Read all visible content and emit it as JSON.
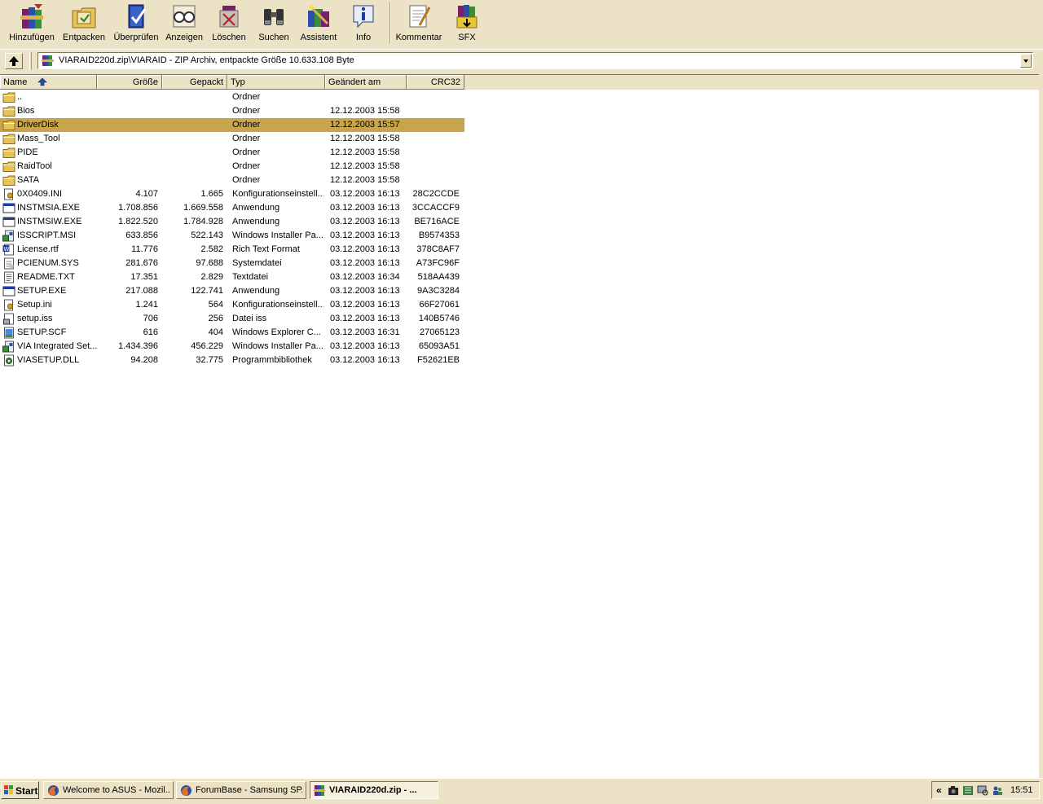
{
  "toolbar": {
    "buttons": [
      {
        "label": "Hinzufügen",
        "icon": "books-add-icon"
      },
      {
        "label": "Entpacken",
        "icon": "extract-folder-icon"
      },
      {
        "label": "Überprüfen",
        "icon": "test-book-icon"
      },
      {
        "label": "Anzeigen",
        "icon": "view-glasses-icon"
      },
      {
        "label": "Löschen",
        "icon": "delete-book-icon"
      },
      {
        "label": "Suchen",
        "icon": "binoculars-icon"
      },
      {
        "label": "Assistent",
        "icon": "wizard-icon"
      },
      {
        "label": "Info",
        "icon": "info-icon"
      },
      {
        "label": "Kommentar",
        "icon": "comment-notepad-icon"
      },
      {
        "label": "SFX",
        "icon": "sfx-icon"
      }
    ]
  },
  "address": {
    "path": "VIARAID220d.zip\\VIARAID - ZIP Archiv, entpackte Größe 10.633.108 Byte"
  },
  "columns": {
    "name": "Name",
    "size": "Größe",
    "packed": "Gepackt",
    "type": "Typ",
    "modified": "Geändert am",
    "crc": "CRC32"
  },
  "files": [
    {
      "name": "..",
      "size": "",
      "packed": "",
      "type": "Ordner",
      "modified": "",
      "crc": "",
      "icon": "folder"
    },
    {
      "name": "Bios",
      "size": "",
      "packed": "",
      "type": "Ordner",
      "modified": "12.12.2003 15:58",
      "crc": "",
      "icon": "folder"
    },
    {
      "name": "DriverDisk",
      "size": "",
      "packed": "",
      "type": "Ordner",
      "modified": "12.12.2003 15:57",
      "crc": "",
      "icon": "folder",
      "selected": true
    },
    {
      "name": "Mass_Tool",
      "size": "",
      "packed": "",
      "type": "Ordner",
      "modified": "12.12.2003 15:58",
      "crc": "",
      "icon": "folder"
    },
    {
      "name": "PIDE",
      "size": "",
      "packed": "",
      "type": "Ordner",
      "modified": "12.12.2003 15:58",
      "crc": "",
      "icon": "folder"
    },
    {
      "name": "RaidTool",
      "size": "",
      "packed": "",
      "type": "Ordner",
      "modified": "12.12.2003 15:58",
      "crc": "",
      "icon": "folder"
    },
    {
      "name": "SATA",
      "size": "",
      "packed": "",
      "type": "Ordner",
      "modified": "12.12.2003 15:58",
      "crc": "",
      "icon": "folder"
    },
    {
      "name": "0X0409.INI",
      "size": "4.107",
      "packed": "1.665",
      "type": "Konfigurationseinstell...",
      "modified": "03.12.2003 16:13",
      "crc": "28C2CCDE",
      "icon": "ini"
    },
    {
      "name": "INSTMSIA.EXE",
      "size": "1.708.856",
      "packed": "1.669.558",
      "type": "Anwendung",
      "modified": "03.12.2003 16:13",
      "crc": "3CCACCF9",
      "icon": "exe"
    },
    {
      "name": "INSTMSIW.EXE",
      "size": "1.822.520",
      "packed": "1.784.928",
      "type": "Anwendung",
      "modified": "03.12.2003 16:13",
      "crc": "BE716ACE",
      "icon": "exe"
    },
    {
      "name": "ISSCRIPT.MSI",
      "size": "633.856",
      "packed": "522.143",
      "type": "Windows Installer Pa...",
      "modified": "03.12.2003 16:13",
      "crc": "B9574353",
      "icon": "msi"
    },
    {
      "name": "License.rtf",
      "size": "11.776",
      "packed": "2.582",
      "type": "Rich Text Format",
      "modified": "03.12.2003 16:13",
      "crc": "378C8AF7",
      "icon": "rtf"
    },
    {
      "name": "PCIENUM.SYS",
      "size": "281.676",
      "packed": "97.688",
      "type": "Systemdatei",
      "modified": "03.12.2003 16:13",
      "crc": "A73FC96F",
      "icon": "sys"
    },
    {
      "name": "README.TXT",
      "size": "17.351",
      "packed": "2.829",
      "type": "Textdatei",
      "modified": "03.12.2003 16:34",
      "crc": "518AA439",
      "icon": "txt"
    },
    {
      "name": "SETUP.EXE",
      "size": "217.088",
      "packed": "122.741",
      "type": "Anwendung",
      "modified": "03.12.2003 16:13",
      "crc": "9A3C3284",
      "icon": "exe"
    },
    {
      "name": "Setup.ini",
      "size": "1.241",
      "packed": "564",
      "type": "Konfigurationseinstell...",
      "modified": "03.12.2003 16:13",
      "crc": "66F27061",
      "icon": "ini"
    },
    {
      "name": "setup.iss",
      "size": "706",
      "packed": "256",
      "type": "Datei iss",
      "modified": "03.12.2003 16:13",
      "crc": "140B5746",
      "icon": "generic"
    },
    {
      "name": "SETUP.SCF",
      "size": "616",
      "packed": "404",
      "type": "Windows Explorer C...",
      "modified": "03.12.2003 16:31",
      "crc": "27065123",
      "icon": "scf"
    },
    {
      "name": "VIA Integrated Set...",
      "size": "1.434.396",
      "packed": "456.229",
      "type": "Windows Installer Pa...",
      "modified": "03.12.2003 16:13",
      "crc": "65093A51",
      "icon": "msi"
    },
    {
      "name": "VIASETUP.DLL",
      "size": "94.208",
      "packed": "32.775",
      "type": "Programmbibliothek",
      "modified": "03.12.2003 16:13",
      "crc": "F52621EB",
      "icon": "dll"
    }
  ],
  "taskbar": {
    "start_label": "Start",
    "tasks": [
      {
        "label": "Welcome to ASUS - Mozil...",
        "icon": "firefox-icon",
        "active": false
      },
      {
        "label": "ForumBase - Samsung SP...",
        "icon": "firefox-icon",
        "active": false
      },
      {
        "label": "VIARAID220d.zip - ...",
        "icon": "winrar-icon",
        "active": true
      }
    ],
    "tray_chevron": "«",
    "clock": "15:51"
  },
  "colors": {
    "chrome": "#ece2c6",
    "selection": "#c8a44a",
    "folder": "#e8c35a"
  }
}
